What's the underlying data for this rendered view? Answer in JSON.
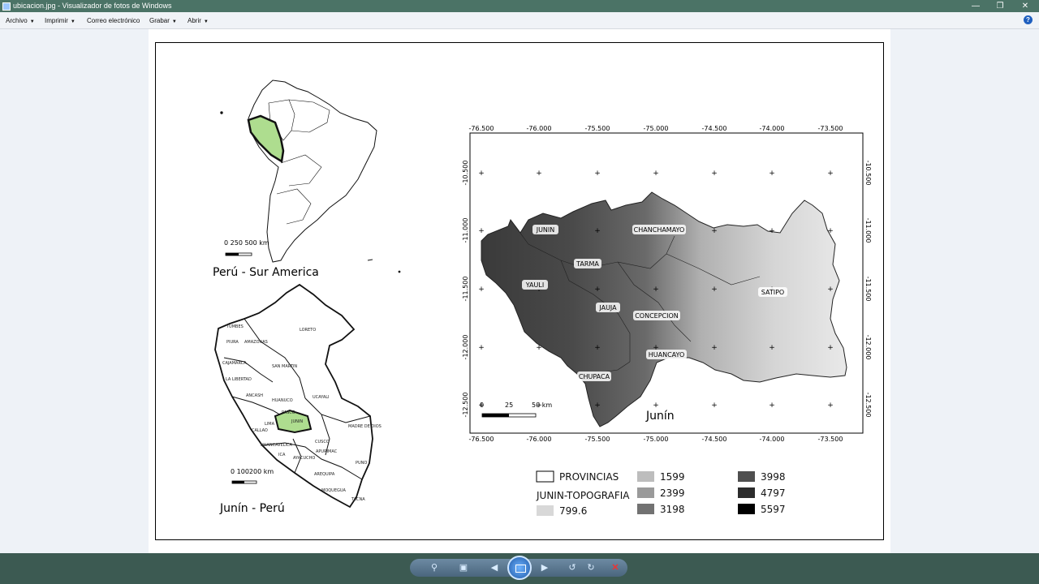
{
  "window": {
    "title": "ubicacion.jpg - Visualizador de fotos de Windows"
  },
  "menu": [
    {
      "label": "Archivo"
    },
    {
      "label": "Imprimir"
    },
    {
      "label": "Correo electrónico"
    },
    {
      "label": "Grabar"
    },
    {
      "label": "Abrir"
    }
  ],
  "help_glyph": "?",
  "maps": {
    "sa_title": "Perú - Sur America",
    "sa_scale": "0  250 500 km",
    "peru_title": "Junín - Perú",
    "peru_scale": "0  100200 km",
    "peru_labels": [
      "TUMBES",
      "PIURA",
      "AMAZONAS",
      "LORETO",
      "CAJAMARCA",
      "LA LIBERTAD",
      "SAN MARTIN",
      "ANCASH",
      "HUANUCO",
      "UCAYALI",
      "PASCO",
      "LIMA",
      "JUNIN",
      "CALLAO",
      "MADRE DE DIOS",
      "HUANCAVELICA",
      "CUSCO",
      "ICA",
      "APURIMAC",
      "AYACUCHO",
      "AREQUIPA",
      "PUNO",
      "MOQUEGUA",
      "TACNA"
    ],
    "main_title": "Junín",
    "main_scale": [
      "0",
      "25",
      "50 km"
    ],
    "x_ticks": [
      "-76.500",
      "-76.000",
      "-75.500",
      "-75.000",
      "-74.500",
      "-74.000",
      "-73.500"
    ],
    "y_ticks": [
      "-10.500",
      "-11.000",
      "-11.500",
      "-12.000",
      "-12.500"
    ],
    "provinces": [
      "JUNIN",
      "CHANCHAMAYO",
      "TARMA",
      "YAULI",
      "SATIPO",
      "JAUJA",
      "CONCEPCION",
      "HUANCAYO",
      "CHUPACA"
    ],
    "legend": {
      "provinces_label": "PROVINCIAS",
      "topo_label": "JUNIN-TOPOGRAFIA",
      "classes": [
        {
          "value": "799.6",
          "color": "#d8d8d8"
        },
        {
          "value": "1599",
          "color": "#bdbdbd"
        },
        {
          "value": "2399",
          "color": "#9a9a9a"
        },
        {
          "value": "3198",
          "color": "#727272"
        },
        {
          "value": "3998",
          "color": "#4f4f4f"
        },
        {
          "value": "4797",
          "color": "#2c2c2c"
        },
        {
          "value": "5597",
          "color": "#000000"
        }
      ]
    },
    "highlight_color": "#aedd8f"
  }
}
